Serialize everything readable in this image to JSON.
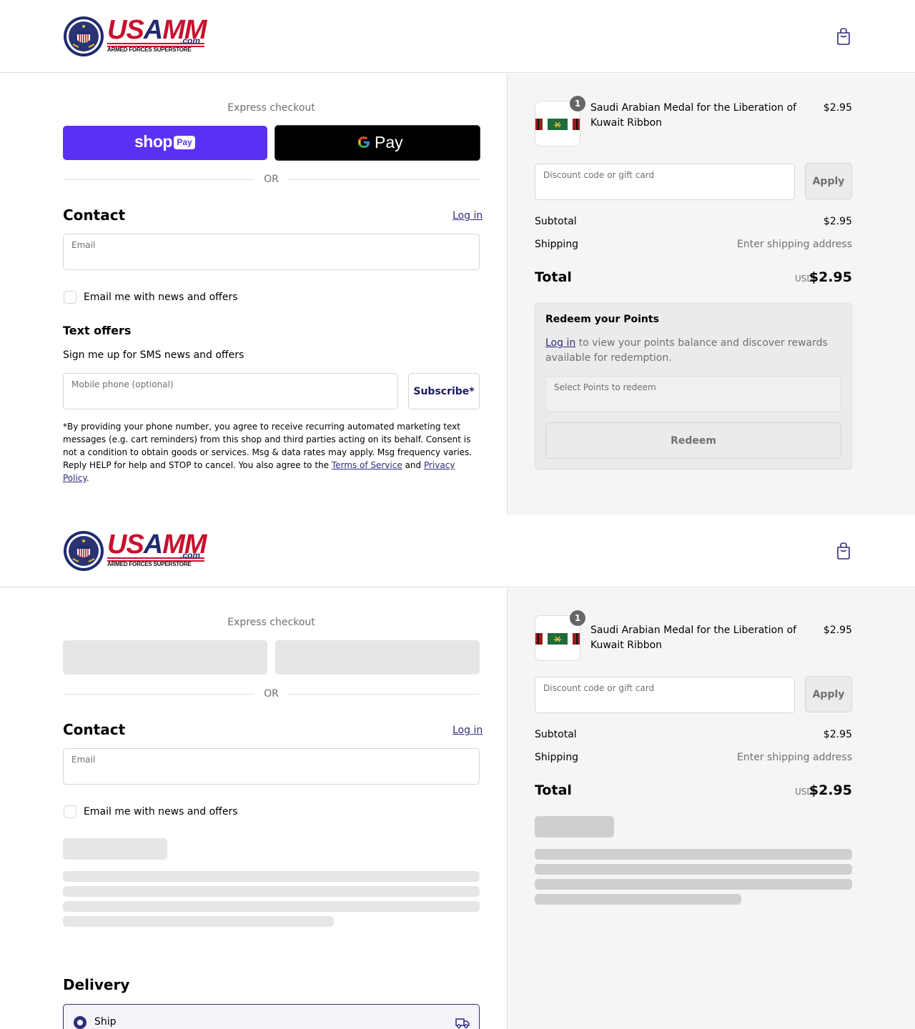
{
  "brand": {
    "name": "USAMM",
    "name_part1": "US",
    "name_part2": "A",
    "name_part3": "MM",
    "domain": ".com",
    "tagline": "ARMED FORCES SUPERSTORE"
  },
  "express": {
    "title": "Express checkout",
    "shop_pay_word": "shop",
    "shop_pay_pill": "Pay",
    "gpay_word": "Pay",
    "or": "OR"
  },
  "contact": {
    "title": "Contact",
    "login": "Log in",
    "email_label": "Email",
    "newsletter_label": "Email me with news and offers"
  },
  "text_offers": {
    "title": "Text offers",
    "subtitle": "Sign me up for SMS news and offers",
    "phone_label": "Mobile phone (optional)",
    "subscribe": "Subscribe*",
    "legal_prefix": "*By providing your phone number, you agree to receive recurring automated marketing text messages (e.g. cart reminders) from this shop and third parties acting on its behalf. Consent is not a condition to obtain goods or services. Msg & data rates may apply. Msg frequency varies. Reply HELP for help and STOP to cancel. You also agree to the ",
    "terms": "Terms of Service",
    "and": " and ",
    "privacy": "Privacy Policy",
    "suffix": "."
  },
  "order": {
    "quantity": "1",
    "product_name": "Saudi Arabian Medal for the Liberation of Kuwait Ribbon",
    "product_price": "$2.95",
    "discount_label": "Discount code or gift card",
    "apply": "Apply",
    "subtotal_label": "Subtotal",
    "subtotal_value": "$2.95",
    "shipping_label": "Shipping",
    "shipping_value": "Enter shipping address",
    "total_label": "Total",
    "currency": "USD",
    "total_value": "$2.95"
  },
  "points": {
    "title": "Redeem your Points",
    "login": "Log in",
    "text": " to view your points balance and discover rewards available for redemption.",
    "select_label": "Select Points to redeem",
    "redeem": "Redeem"
  },
  "delivery": {
    "title": "Delivery",
    "ship_label": "Ship"
  },
  "colors": {
    "accent": "#2c2c7c",
    "shop_pay": "#5a31f4",
    "brand_red": "#c8102e",
    "brand_blue": "#1f2b6e"
  }
}
